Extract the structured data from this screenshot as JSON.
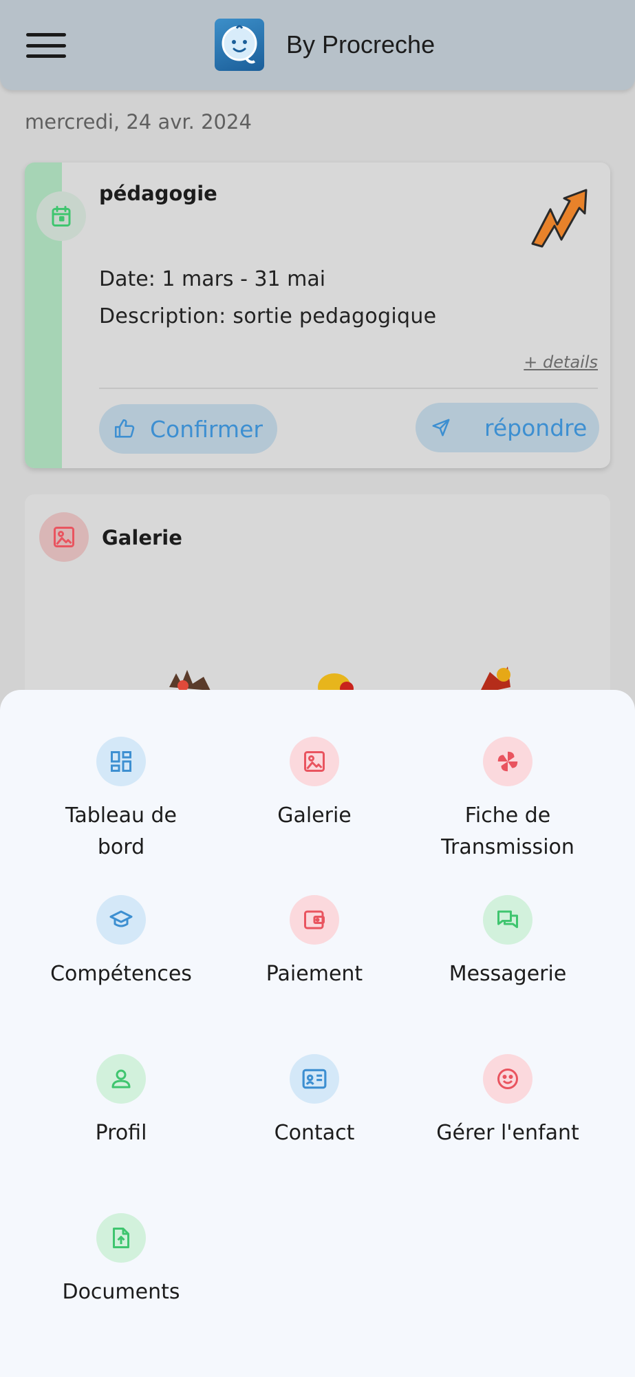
{
  "header": {
    "title": "By Procreche",
    "menu_icon": "hamburger-icon",
    "logo_icon": "baby-face-logo"
  },
  "feed": {
    "date": "mercredi, 24 avr. 2024",
    "event": {
      "title": "pédagogie",
      "date_text": "Date: 1 mars - 31 mai",
      "description_text": "Description: sortie pedagogique",
      "details_link": "+ details",
      "confirm_label": "Confirmer",
      "reply_label": "répondre",
      "icon": "calendar-icon",
      "badge_icon": "zigzag-arrow-icon"
    },
    "gallery": {
      "title": "Galerie",
      "icon": "image-icon"
    }
  },
  "menu": {
    "items": [
      {
        "label": "Tableau de\nbord",
        "icon": "dashboard-icon",
        "color": "blue"
      },
      {
        "label": "Galerie",
        "icon": "image-icon",
        "color": "red"
      },
      {
        "label": "Fiche de\nTransmission",
        "icon": "pinwheel-icon",
        "color": "red"
      },
      {
        "label": "Compétences",
        "icon": "graduation-cap-icon",
        "color": "blue"
      },
      {
        "label": "Paiement",
        "icon": "wallet-icon",
        "color": "red"
      },
      {
        "label": "Messagerie",
        "icon": "chat-icon",
        "color": "green"
      },
      {
        "label": "Profil",
        "icon": "user-icon",
        "color": "green"
      },
      {
        "label": "Contact",
        "icon": "contact-card-icon",
        "color": "blue"
      },
      {
        "label": "Gérer l'enfant",
        "icon": "smiley-icon",
        "color": "red"
      },
      {
        "label": "Documents",
        "icon": "file-upload-icon",
        "color": "green"
      }
    ]
  },
  "colors": {
    "accent_blue": "#3d8fd1",
    "green": "#3fc56f",
    "red": "#e9545f",
    "header_bg": "#b7c1c9",
    "sheet_bg": "#f5f8fd"
  }
}
